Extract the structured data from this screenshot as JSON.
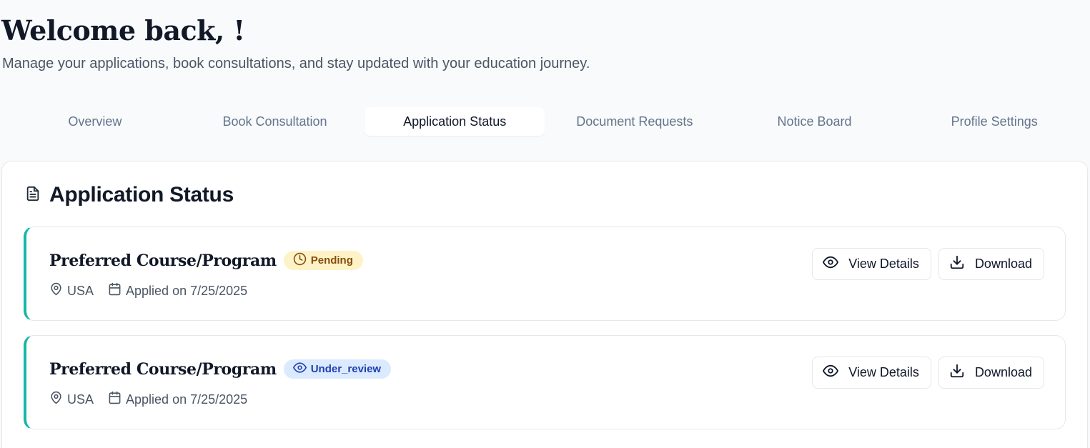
{
  "header": {
    "title": "Welcome back, !",
    "subtitle": "Manage your applications, book consultations, and stay updated with your education journey."
  },
  "tabs": [
    {
      "label": "Overview"
    },
    {
      "label": "Book Consultation"
    },
    {
      "label": "Application Status",
      "active": true
    },
    {
      "label": "Document Requests"
    },
    {
      "label": "Notice Board"
    },
    {
      "label": "Profile Settings"
    }
  ],
  "panel": {
    "title": "Application Status",
    "icon": "file-text-icon"
  },
  "applications": [
    {
      "course": "Preferred Course/Program",
      "status": "Pending",
      "status_icon": "clock-icon",
      "country": "USA",
      "applied": "Applied on 7/25/2025",
      "view_label": "View Details",
      "download_label": "Download"
    },
    {
      "course": "Preferred Course/Program",
      "status": "Under_review",
      "status_icon": "eye-icon",
      "country": "USA",
      "applied": "Applied on 7/25/2025",
      "view_label": "View Details",
      "download_label": "Download"
    }
  ],
  "colors": {
    "accent": "#14b8a6",
    "pending_bg": "#fef3c7",
    "pending_text": "#854d0e",
    "review_bg": "#dbeafe",
    "review_text": "#1e40af"
  }
}
